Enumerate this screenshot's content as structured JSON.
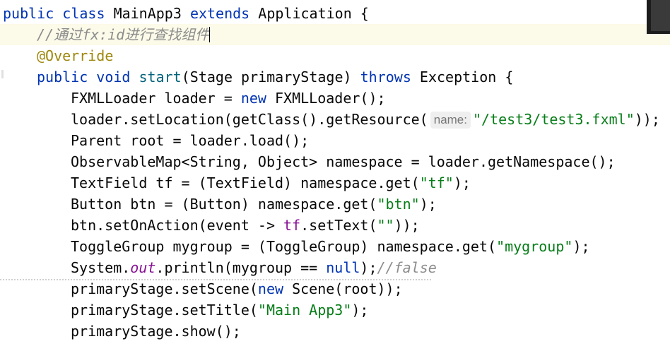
{
  "code": {
    "l1": {
      "kw1": "public",
      "kw2": "class",
      "name": "MainApp3",
      "kw3": "extends",
      "parent": "Application",
      "brace": "{"
    },
    "l2": {
      "comment": "//通过fx:id进行查找组件"
    },
    "l3": {
      "annotation": "@Override"
    },
    "l4": {
      "kw1": "public",
      "kw2": "void",
      "method": "start",
      "params": "(Stage primaryStage)",
      "kw3": "throws",
      "exc": "Exception",
      "brace": "{"
    },
    "l5": {
      "a": "FXMLLoader loader = ",
      "kw": "new",
      "b": "FXMLLoader();"
    },
    "l6": {
      "a": "loader.setLocation(getClass().getResource(",
      "hint": "name:",
      "str": "\"/test3/test3.fxml\"",
      "b": "));"
    },
    "l7": {
      "a": "Parent root = loader.load();"
    },
    "l8": {
      "a": "ObservableMap<String, Object> namespace = loader.getNamespace();"
    },
    "l9": {
      "a": "TextField tf = (TextField) namespace.get(",
      "str": "\"tf\"",
      "b": ");"
    },
    "l10": {
      "a": "Button btn = (Button) namespace.get(",
      "str": "\"btn\"",
      "b": ");"
    },
    "l11": {
      "a": "btn.setOnAction(event -> ",
      "field": "tf",
      "b": ".setText(",
      "str": "\"\"",
      "c": "));"
    },
    "l12": {
      "a": "ToggleGroup mygroup = (ToggleGroup) namespace.get(",
      "str": "\"mygroup\"",
      "b": ");"
    },
    "l13": {
      "a": "System.",
      "sfield": "out",
      "b": ".println(mygroup == ",
      "kw": "null",
      "c": ");",
      "comment": "//false"
    },
    "l14": {
      "a": "primaryStage.setScene(",
      "kw": "new",
      "b": "Scene(root));"
    },
    "l15": {
      "a": "primaryStage.setTitle(",
      "str": "\"Main App3\"",
      "b": ");"
    },
    "l16": {
      "a": "primaryStage.show();"
    }
  },
  "colors": {
    "keyword": "#0033b3",
    "string": "#067d17",
    "annotation": "#9e880d",
    "comment": "#8c8c8c",
    "field": "#871094",
    "method_decl": "#00627a",
    "current_line": "#fcfae8"
  }
}
